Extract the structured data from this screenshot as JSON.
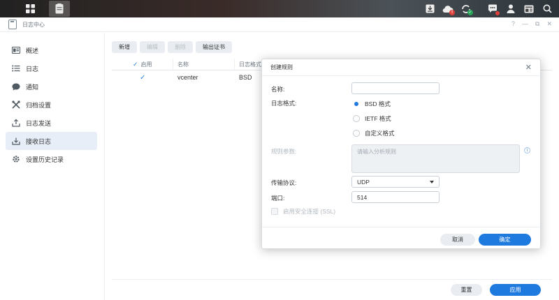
{
  "window": {
    "title": "日志中心",
    "controls": [
      "?",
      "—",
      "⧉",
      "✕"
    ]
  },
  "sidebar": {
    "items": [
      {
        "label": "概述",
        "icon": "overview-icon"
      },
      {
        "label": "日志",
        "icon": "list-icon"
      },
      {
        "label": "通知",
        "icon": "chat-bubble-icon"
      },
      {
        "label": "归档设置",
        "icon": "tools-icon"
      },
      {
        "label": "日志发送",
        "icon": "upload-icon"
      },
      {
        "label": "接收日志",
        "icon": "inbox-icon",
        "selected": true
      },
      {
        "label": "设置历史记录",
        "icon": "gear-icon"
      }
    ]
  },
  "toolbar": {
    "add": "新增",
    "edit": "编辑",
    "delete": "删除",
    "export_cert": "输出证书"
  },
  "grid": {
    "columns": {
      "enabled": "启用",
      "name": "名称",
      "format": "日志格式"
    },
    "rows": [
      {
        "enabled": true,
        "name": "vcenter",
        "format": "BSD"
      }
    ]
  },
  "footer": {
    "reset": "重置",
    "apply": "应用"
  },
  "dialog": {
    "title": "创建规则",
    "name_label": "名称:",
    "name_value": "",
    "format_label": "日志格式:",
    "formats": [
      {
        "label": "BSD 格式",
        "selected": true
      },
      {
        "label": "IETF 格式",
        "selected": false
      },
      {
        "label": "自定义格式",
        "selected": false
      }
    ],
    "rule_params_label": "规则参数:",
    "rule_params_placeholder": "请输入分析规则",
    "protocol_label": "传输协议:",
    "protocol_value": "UDP",
    "port_label": "端口:",
    "port_value": "514",
    "ssl_label": "启用安全连接 (SSL)",
    "cancel": "取消",
    "ok": "确定"
  },
  "colors": {
    "accent": "#1f7ae0",
    "selected_bg": "#e7eef8",
    "badge_red": "#e0403a",
    "badge_green": "#27a35a"
  }
}
